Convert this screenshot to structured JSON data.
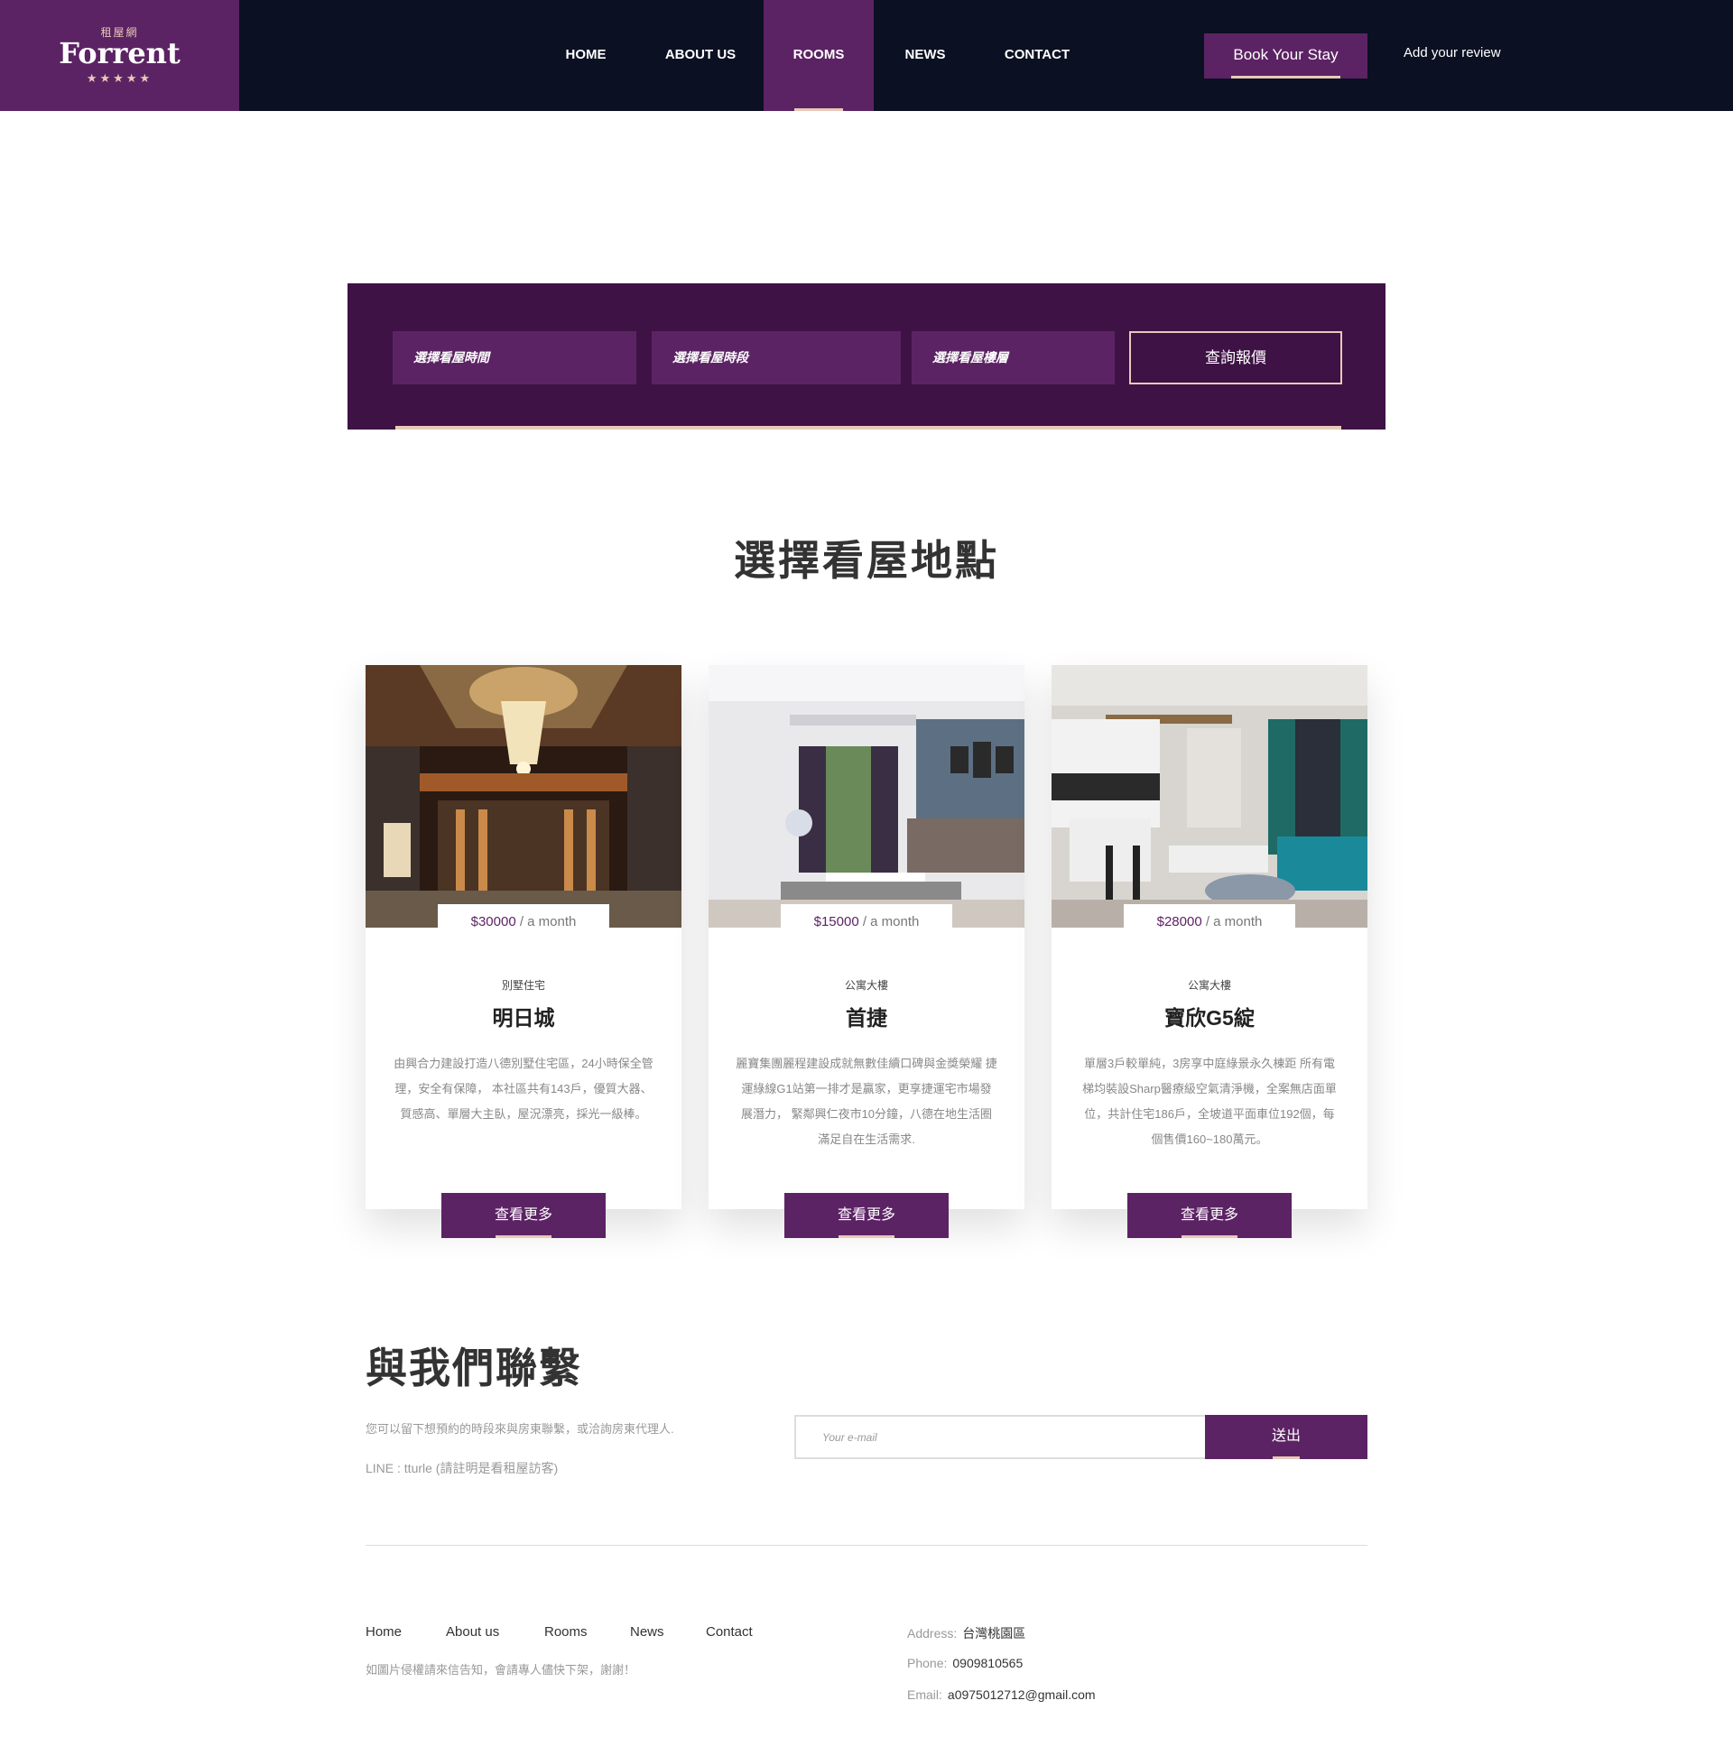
{
  "header": {
    "logo": {
      "subtitle": "租屋網",
      "title": "Forrent",
      "stars": "★★★★★"
    },
    "nav": [
      {
        "label": "HOME",
        "active": false
      },
      {
        "label": "ABOUT US",
        "active": false
      },
      {
        "label": "ROOMS",
        "active": true
      },
      {
        "label": "NEWS",
        "active": false
      },
      {
        "label": "CONTACT",
        "active": false
      }
    ],
    "book_button": "Book Your Stay",
    "review_link": "Add your review"
  },
  "search": {
    "field_date": "選擇看屋時間",
    "field_period": "選擇看屋時段",
    "field_floor": "選擇看屋樓層",
    "submit": "查詢報價"
  },
  "locations": {
    "title": "選擇看屋地點",
    "cards": [
      {
        "price": "$30000",
        "period": " / a month",
        "category": "別墅住宅",
        "name": "明日城",
        "desc": "由興合力建設打造八德別墅住宅區，24小時保全管理，安全有保障， 本社區共有143戶，優質大器、質感高、單層大主臥，屋況漂亮，採光一級棒。",
        "button": "查看更多"
      },
      {
        "price": "$15000",
        "period": " / a month",
        "category": "公寓大樓",
        "name": "首捷",
        "desc": "麗寶集團麗程建設成就無數佳續口碑與金獎榮耀 捷運綠線G1站第一排才是贏家，更享捷運宅市場發展潛力， 緊鄰興仁夜市10分鐘，八德在地生活圈滿足自在生活需求.",
        "button": "查看更多"
      },
      {
        "price": "$28000",
        "period": " / a month",
        "category": "公寓大樓",
        "name": "寶欣G5綻",
        "desc": "單層3戶較單純，3房享中庭綠景永久棟距 所有電梯均裝設Sharp醫療級空氣清淨機，全案無店面單位，共計住宅186戶，全坡道平面車位192個，每個售價160~180萬元。",
        "button": "查看更多"
      }
    ]
  },
  "contact": {
    "title": "與我們聯繫",
    "text": "您可以留下想預約的時段來與房東聯繫，或洽詢房東代理人.",
    "line": "LINE : tturle (請註明是看租屋訪客)",
    "email_placeholder": "Your e-mail",
    "send": "送出"
  },
  "footer": {
    "links": [
      "Home",
      "About us",
      "Rooms",
      "News",
      "Contact"
    ],
    "note": "如圖片侵權請來信告知，會請專人儘快下架，謝謝！",
    "address_label": "Address:",
    "address": "台灣桃園區",
    "phone_label": "Phone:",
    "phone": "0909810565",
    "email_label": "Email:",
    "email": "a0975012712@gmail.com"
  },
  "colors": {
    "navy": "#0b1022",
    "purple": "#5c2364",
    "dark_purple": "#3e1245",
    "accent": "#e9c9b8"
  }
}
